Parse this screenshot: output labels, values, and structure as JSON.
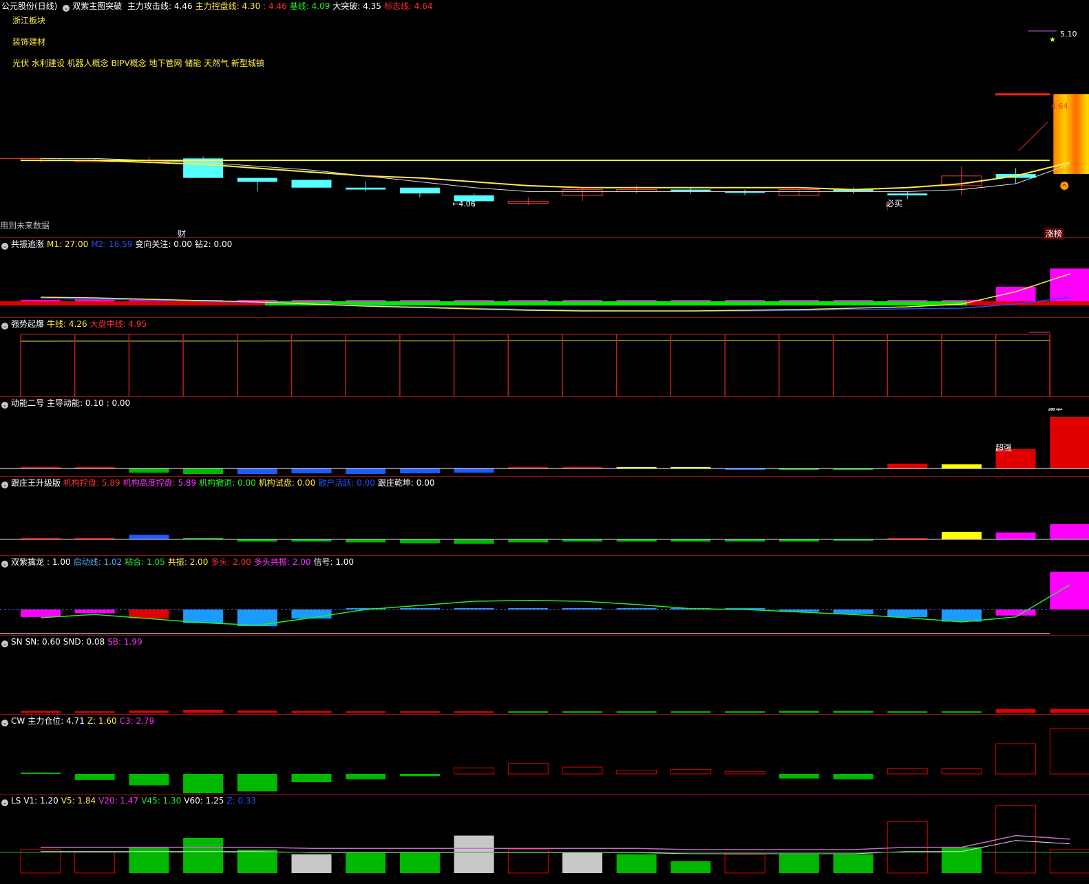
{
  "main": {
    "stock_title": "公元股份(日线)",
    "indicator": "双紫主图突破",
    "lines": [
      {
        "label": "主力攻击线:",
        "value": "4.46",
        "color": "#ffffff"
      },
      {
        "label": "主力控盘线:",
        "value": "4.30",
        "color": "#ffe94a"
      },
      {
        "label": ":",
        "value": "4.46",
        "color": "#ff3030"
      },
      {
        "label": "基线:",
        "value": "4.09",
        "color": "#22ee22"
      },
      {
        "label": "大突破:",
        "value": "4.35",
        "color": "#ffffff"
      },
      {
        "label": "标志线:",
        "value": "4.64",
        "color": "#ff3030"
      }
    ],
    "info_lines": [
      "浙江板块",
      "装饰建材",
      "光伏 水利建设 机器人概念 BIPV概念 地下管网 储能 天然气 新型城镇"
    ],
    "price_high_label": "4.64",
    "price_top_label": "5.10",
    "low_label": "←4.06",
    "buy_label": "必买",
    "future_label": "用到未来数据",
    "cai_label": "财",
    "zhangting_label": "涨榜"
  },
  "panels": [
    {
      "id": "p1",
      "name": "共振追涨",
      "items": [
        {
          "label": "M1:",
          "value": "27.00",
          "color": "#ffe94a"
        },
        {
          "label": "M2:",
          "value": "16.59",
          "color": "#2050ff"
        },
        {
          "label": "变向关注:",
          "value": "0.00",
          "color": "#ffffff"
        },
        {
          "label": "钻2:",
          "value": "0.00",
          "color": "#ffffff"
        }
      ]
    },
    {
      "id": "p2",
      "name": "强势起爆",
      "items": [
        {
          "label": "牛线:",
          "value": "4.26",
          "color": "#ffe94a"
        },
        {
          "label": "大盘中线:",
          "value": "4.95",
          "color": "#ff3030"
        }
      ]
    },
    {
      "id": "p3",
      "name": "动能二号",
      "items": [
        {
          "label": "主导动能:",
          "value": "0.10",
          "color": "#ffffff"
        },
        {
          "label": ":",
          "value": "0.00",
          "color": "#ffffff"
        }
      ],
      "tag1": "超强",
      "tag2": "爆发"
    },
    {
      "id": "p4",
      "name": "跟庄王升级版",
      "items": [
        {
          "label": "机构控盘:",
          "value": "5.89",
          "color": "#ff3030"
        },
        {
          "label": "机构高度控盘:",
          "value": "5.89",
          "color": "#ff33ff"
        },
        {
          "label": "机构撤退:",
          "value": "0.00",
          "color": "#22ee22"
        },
        {
          "label": "机构试盘:",
          "value": "0.00",
          "color": "#ffe94a"
        },
        {
          "label": "散户活跃:",
          "value": "0.00",
          "color": "#2050ff"
        },
        {
          "label": "跟庄乾坤:",
          "value": "0.00",
          "color": "#ffffff"
        }
      ]
    },
    {
      "id": "p5",
      "name": "双紫擒龙",
      "items": [
        {
          "label": ":",
          "value": "1.00",
          "color": "#ffffff"
        },
        {
          "label": "启动线:",
          "value": "1.02",
          "color": "#5aa8ff"
        },
        {
          "label": "粘合:",
          "value": "1.05",
          "color": "#22ee22"
        },
        {
          "label": "共振:",
          "value": "2.00",
          "color": "#ffe94a"
        },
        {
          "label": "多头:",
          "value": "2.00",
          "color": "#ff3030"
        },
        {
          "label": "多头共振:",
          "value": "2.00",
          "color": "#ff33ff"
        },
        {
          "label": "信号:",
          "value": "1.00",
          "color": "#ffffff"
        }
      ]
    },
    {
      "id": "p6",
      "name": "SN",
      "items": [
        {
          "label": "SN:",
          "value": "0.60",
          "color": "#ffffff"
        },
        {
          "label": "SND:",
          "value": "0.08",
          "color": "#ffffff"
        },
        {
          "label": "SB:",
          "value": "1.99",
          "color": "#ff33ff"
        }
      ]
    },
    {
      "id": "p7",
      "name": "CW",
      "items": [
        {
          "label": "主力仓位:",
          "value": "4.71",
          "color": "#ffffff"
        },
        {
          "label": "Z:",
          "value": "1.60",
          "color": "#ffe94a"
        },
        {
          "label": "C3:",
          "value": "2.79",
          "color": "#ff33ff"
        }
      ]
    },
    {
      "id": "p8",
      "name": "LS",
      "items": [
        {
          "label": "V1:",
          "value": "1.20",
          "color": "#ffffff"
        },
        {
          "label": "V5:",
          "value": "1.84",
          "color": "#ffe94a"
        },
        {
          "label": "V20:",
          "value": "1.47",
          "color": "#ff33ff"
        },
        {
          "label": "V45:",
          "value": "1.30",
          "color": "#22ee22"
        },
        {
          "label": "V60:",
          "value": "1.25",
          "color": "#ffffff"
        },
        {
          "label": "Z:",
          "value": "0.33",
          "color": "#2050ff"
        }
      ]
    }
  ],
  "chart_data": {
    "type": "candlestick",
    "bars": 20,
    "candles": [
      {
        "o": 4.31,
        "h": 4.31,
        "l": 4.29,
        "c": 4.3,
        "up": true
      },
      {
        "o": 4.3,
        "h": 4.31,
        "l": 4.29,
        "c": 4.3,
        "up": true
      },
      {
        "o": 4.3,
        "h": 4.32,
        "l": 4.28,
        "c": 4.3,
        "up": true
      },
      {
        "o": 4.31,
        "h": 4.32,
        "l": 4.21,
        "c": 4.21,
        "up": false
      },
      {
        "o": 4.21,
        "h": 4.21,
        "l": 4.14,
        "c": 4.19,
        "up": false
      },
      {
        "o": 4.2,
        "h": 4.2,
        "l": 4.16,
        "c": 4.16,
        "up": false
      },
      {
        "o": 4.16,
        "h": 4.19,
        "l": 4.14,
        "c": 4.15,
        "up": false
      },
      {
        "o": 4.16,
        "h": 4.16,
        "l": 4.11,
        "c": 4.13,
        "up": false
      },
      {
        "o": 4.12,
        "h": 4.13,
        "l": 4.06,
        "c": 4.09,
        "up": false
      },
      {
        "o": 4.09,
        "h": 4.11,
        "l": 4.07,
        "c": 4.08,
        "up": true
      },
      {
        "o": 4.12,
        "h": 4.16,
        "l": 4.09,
        "c": 4.15,
        "up": true
      },
      {
        "o": 4.14,
        "h": 4.17,
        "l": 4.13,
        "c": 4.15,
        "up": true
      },
      {
        "o": 4.15,
        "h": 4.16,
        "l": 4.13,
        "c": 4.14,
        "up": false
      },
      {
        "o": 4.14,
        "h": 4.15,
        "l": 4.12,
        "c": 4.14,
        "up": false
      },
      {
        "o": 4.12,
        "h": 4.15,
        "l": 4.12,
        "c": 4.15,
        "up": true
      },
      {
        "o": 4.15,
        "h": 4.16,
        "l": 4.13,
        "c": 4.14,
        "up": false
      },
      {
        "o": 4.13,
        "h": 4.14,
        "l": 4.1,
        "c": 4.12,
        "up": false
      },
      {
        "o": 4.17,
        "h": 4.27,
        "l": 4.12,
        "c": 4.22,
        "up": true
      },
      {
        "o": 4.21,
        "h": 4.26,
        "l": 4.18,
        "c": 4.23,
        "up": false
      },
      {
        "o": 4.23,
        "h": 4.64,
        "l": 4.23,
        "c": 4.64,
        "up": true
      }
    ],
    "ma_white": [
      4.31,
      4.31,
      4.3,
      4.29,
      4.27,
      4.25,
      4.22,
      4.19,
      4.16,
      4.14,
      4.14,
      4.14,
      4.14,
      4.14,
      4.14,
      4.14,
      4.14,
      4.15,
      4.18,
      4.28
    ],
    "ma_yellow": [
      4.3,
      4.3,
      4.29,
      4.28,
      4.26,
      4.24,
      4.22,
      4.21,
      4.19,
      4.17,
      4.16,
      4.16,
      4.16,
      4.16,
      4.16,
      4.15,
      4.16,
      4.18,
      4.22,
      4.29
    ],
    "flat_yellow": 4.3,
    "ylim": [
      4.0,
      4.7
    ],
    "p1_bars": [
      0.4,
      0.7,
      0.3,
      0,
      0,
      0,
      0,
      0,
      0,
      0,
      0,
      0,
      0,
      0,
      0,
      0,
      0,
      0,
      4.0,
      9.0
    ],
    "p3_bars": [
      {
        "v": 0.1,
        "c": "r"
      },
      {
        "v": 0.1,
        "c": "r"
      },
      {
        "v": -0.6,
        "c": "g"
      },
      {
        "v": -0.8,
        "c": "g"
      },
      {
        "v": -0.8,
        "c": "b"
      },
      {
        "v": -0.7,
        "c": "b"
      },
      {
        "v": -0.8,
        "c": "b"
      },
      {
        "v": -0.7,
        "c": "b"
      },
      {
        "v": -0.6,
        "c": "b"
      },
      {
        "v": 0,
        "c": "r"
      },
      {
        "v": 0.1,
        "c": "r"
      },
      {
        "v": 0,
        "c": "y"
      },
      {
        "v": 0,
        "c": "y"
      },
      {
        "v": -0.1,
        "c": "b"
      },
      {
        "v": -0.1,
        "c": "g"
      },
      {
        "v": -0.2,
        "c": "g"
      },
      {
        "v": 0.7,
        "c": "r"
      },
      {
        "v": 0.6,
        "c": "y"
      },
      {
        "v": 2.8,
        "c": "r"
      },
      {
        "v": 7.5,
        "c": "r"
      }
    ],
    "p4_bars": [
      {
        "v": 0.2,
        "c": "r"
      },
      {
        "v": 0.2,
        "c": "r"
      },
      {
        "v": 0.6,
        "c": "b"
      },
      {
        "v": 0,
        "c": "g"
      },
      {
        "v": -0.3,
        "c": "g"
      },
      {
        "v": -0.3,
        "c": "g"
      },
      {
        "v": -0.4,
        "c": "g"
      },
      {
        "v": -0.5,
        "c": "g"
      },
      {
        "v": -0.6,
        "c": "g"
      },
      {
        "v": -0.4,
        "c": "g"
      },
      {
        "v": -0.3,
        "c": "g"
      },
      {
        "v": -0.3,
        "c": "g"
      },
      {
        "v": -0.3,
        "c": "g"
      },
      {
        "v": -0.3,
        "c": "g"
      },
      {
        "v": -0.3,
        "c": "g"
      },
      {
        "v": -0.2,
        "c": "g"
      },
      {
        "v": 0,
        "c": "r"
      },
      {
        "v": 1.0,
        "c": "y"
      },
      {
        "v": 0.9,
        "c": "m"
      },
      {
        "v": 2.0,
        "c": "m"
      }
    ],
    "p5_bars": [
      {
        "v": -1,
        "c": "m"
      },
      {
        "v": -0.5,
        "c": "m"
      },
      {
        "v": -1.2,
        "c": "r"
      },
      {
        "v": -1.8,
        "c": "c"
      },
      {
        "v": -2.2,
        "c": "c"
      },
      {
        "v": -1.2,
        "c": "c"
      },
      {
        "v": 0,
        "c": "c"
      },
      {
        "v": 0,
        "c": "c"
      },
      {
        "v": 0,
        "c": "c"
      },
      {
        "v": 0,
        "c": "c"
      },
      {
        "v": 0,
        "c": "c"
      },
      {
        "v": 0,
        "c": "c"
      },
      {
        "v": 0,
        "c": "c"
      },
      {
        "v": 0,
        "c": "c"
      },
      {
        "v": -0.3,
        "c": "c"
      },
      {
        "v": -0.6,
        "c": "c"
      },
      {
        "v": -1.0,
        "c": "c"
      },
      {
        "v": -1.6,
        "c": "c"
      },
      {
        "v": -0.8,
        "c": "m"
      },
      {
        "v": 5.0,
        "c": "m"
      }
    ],
    "p5_line": [
      -1.0,
      -0.6,
      -1.1,
      -1.6,
      -1.9,
      -1.0,
      0.0,
      0.5,
      1.0,
      1.1,
      1.0,
      0.6,
      0.1,
      0.0,
      -0.3,
      -0.6,
      -1.0,
      -1.5,
      -0.9,
      3.0
    ],
    "p6_bars": [
      {
        "v": 0.3,
        "c": "r"
      },
      {
        "v": 0.25,
        "c": "r"
      },
      {
        "v": 0.35,
        "c": "r"
      },
      {
        "v": 0.45,
        "c": "r"
      },
      {
        "v": 0.35,
        "c": "r"
      },
      {
        "v": 0.3,
        "c": "r"
      },
      {
        "v": 0.2,
        "c": "r"
      },
      {
        "v": 0.2,
        "c": "r"
      },
      {
        "v": 0.15,
        "c": "r"
      },
      {
        "v": 0.1,
        "c": "g"
      },
      {
        "v": 0.1,
        "c": "g"
      },
      {
        "v": 0.1,
        "c": "g"
      },
      {
        "v": 0.1,
        "c": "g"
      },
      {
        "v": 0.15,
        "c": "g"
      },
      {
        "v": 0.3,
        "c": "g"
      },
      {
        "v": 0.3,
        "c": "g"
      },
      {
        "v": 0.2,
        "c": "g"
      },
      {
        "v": 0.1,
        "c": "g"
      },
      {
        "v": 0.6,
        "c": "r"
      },
      {
        "v": 0.6,
        "c": "r"
      }
    ],
    "p7_bars": [
      {
        "v": 0,
        "c": "g"
      },
      {
        "v": -0.8,
        "c": "g"
      },
      {
        "v": -1.5,
        "c": "g"
      },
      {
        "v": -2.6,
        "c": "g"
      },
      {
        "v": -2.3,
        "c": "g"
      },
      {
        "v": -1.1,
        "c": "g"
      },
      {
        "v": -0.7,
        "c": "g"
      },
      {
        "v": -0.3,
        "c": "g"
      },
      {
        "v": 0.8,
        "c": "ro"
      },
      {
        "v": 1.4,
        "c": "ro"
      },
      {
        "v": 0.9,
        "c": "ro"
      },
      {
        "v": 0.5,
        "c": "ro"
      },
      {
        "v": 0.6,
        "c": "ro"
      },
      {
        "v": 0.3,
        "c": "ro"
      },
      {
        "v": -0.6,
        "c": "g"
      },
      {
        "v": -0.7,
        "c": "g"
      },
      {
        "v": 0.7,
        "c": "ro"
      },
      {
        "v": 0.7,
        "c": "ro"
      },
      {
        "v": 4.0,
        "c": "ro"
      },
      {
        "v": 6.0,
        "c": "ro"
      }
    ],
    "p8_bars": [
      {
        "v": 1.0,
        "c": "ro"
      },
      {
        "v": 0.9,
        "c": "ro"
      },
      {
        "v": 1.1,
        "c": "g"
      },
      {
        "v": 1.5,
        "c": "g"
      },
      {
        "v": 1.0,
        "c": "g"
      },
      {
        "v": 0.8,
        "c": "w"
      },
      {
        "v": 0.9,
        "c": "g"
      },
      {
        "v": 0.9,
        "c": "g"
      },
      {
        "v": 1.6,
        "c": "w"
      },
      {
        "v": 1.0,
        "c": "ro"
      },
      {
        "v": 0.9,
        "c": "w"
      },
      {
        "v": 0.8,
        "c": "g"
      },
      {
        "v": 0.5,
        "c": "g"
      },
      {
        "v": 0.8,
        "c": "ro"
      },
      {
        "v": 0.8,
        "c": "g"
      },
      {
        "v": 0.8,
        "c": "g"
      },
      {
        "v": 2.2,
        "c": "ro"
      },
      {
        "v": 1.1,
        "c": "g"
      },
      {
        "v": 2.9,
        "c": "ro"
      },
      {
        "v": 1.0,
        "c": "ro"
      }
    ],
    "p8_line": [
      1.1,
      1.1,
      1.1,
      1.1,
      1.1,
      1.05,
      1.05,
      1.05,
      1.05,
      1.05,
      1.05,
      1.05,
      1.0,
      1.0,
      1.0,
      1.0,
      1.1,
      1.1,
      1.6,
      1.45
    ]
  }
}
